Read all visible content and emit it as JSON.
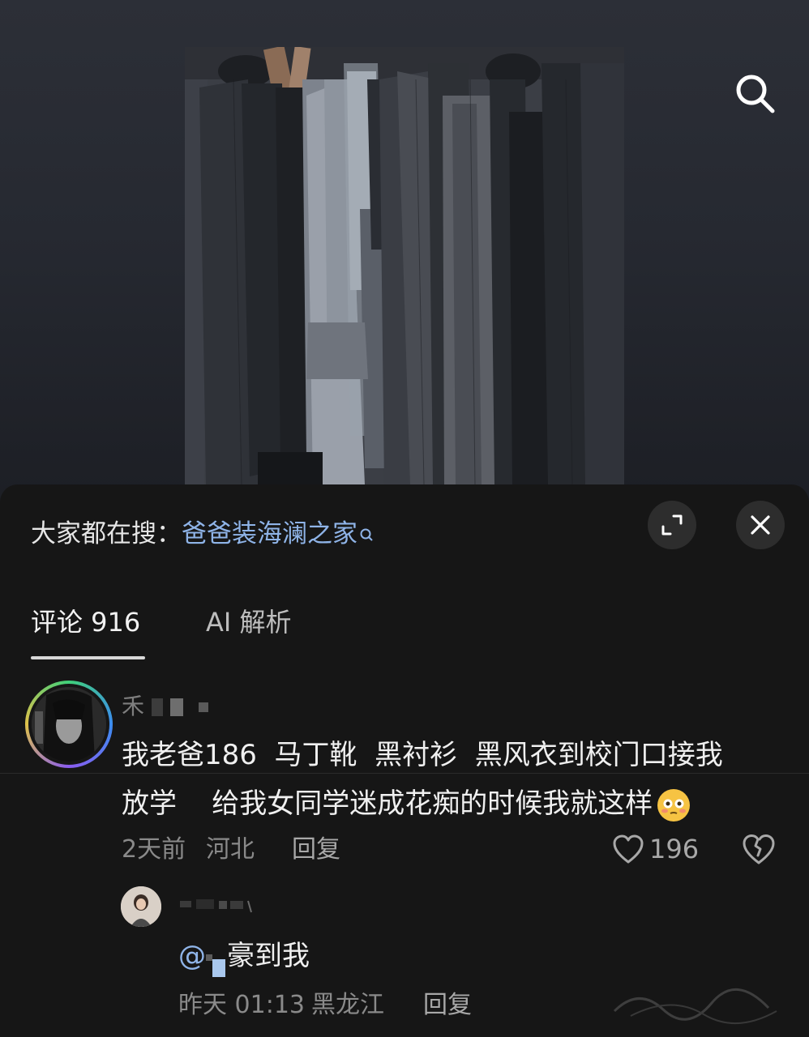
{
  "video": {
    "search_icon": "search-icon"
  },
  "sheet": {
    "hot_search": {
      "prefix": "大家都在搜：",
      "link": "爸爸装海澜之家",
      "icon": "search-small-icon"
    },
    "expand_icon": "expand-icon",
    "close_icon": "close-icon",
    "tabs": [
      {
        "label": "评论 916",
        "active": true
      },
      {
        "label": "AI 解析",
        "active": false
      }
    ]
  },
  "comment": {
    "username": "禾",
    "line1": "我老爸186  马丁靴  黑衬衫  黑风衣到校门口接我",
    "line2": "放学    给我女同学迷成花痴的时候我就这样",
    "emoji": "flushed-face-emoji",
    "time": "2天前",
    "location": "河北",
    "reply_label": "回复",
    "likes": "196",
    "like_icon": "heart-icon",
    "dislike_icon": "broken-heart-icon"
  },
  "reply": {
    "mention": "@",
    "text": "豪到我",
    "time": "昨天 01:13",
    "location": "黑龙江",
    "reply_label": "回复"
  },
  "colors": {
    "background": "#161616",
    "link_blue": "#8fb4e8",
    "muted_text": "#8a8a8a"
  }
}
